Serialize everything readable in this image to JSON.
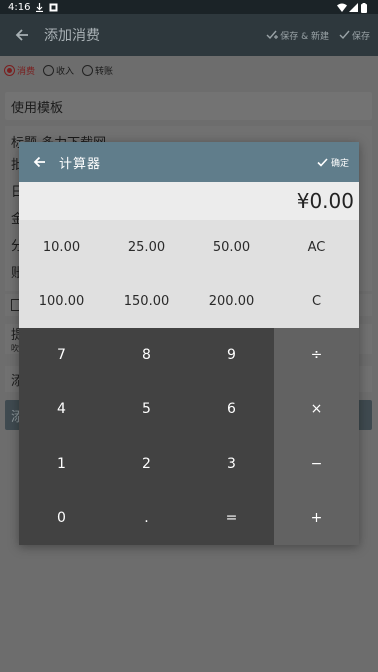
{
  "status_bar": {
    "time": "4:16"
  },
  "toolbar": {
    "title": "添加消费",
    "save_new_label": "保存 & 新建",
    "save_label": "保存"
  },
  "form": {
    "types": [
      {
        "label": "消费",
        "selected": true
      },
      {
        "label": "收入",
        "selected": false
      },
      {
        "label": "转账",
        "selected": false
      }
    ],
    "template_label": "使用模板",
    "title_field": "标题 多力下载网",
    "partial_labels": [
      "批",
      "日",
      "金",
      "分",
      "账"
    ],
    "peek_rows": [
      "提",
      "添"
    ],
    "peek_detail": "吹",
    "peek_button": "添"
  },
  "calculator": {
    "title": "计算器",
    "confirm_label": "确定",
    "display_value": "¥0.00",
    "presets": [
      "10.00",
      "25.00",
      "50.00",
      "AC",
      "100.00",
      "150.00",
      "200.00",
      "C"
    ],
    "keys": [
      "7",
      "8",
      "9",
      "÷",
      "4",
      "5",
      "6",
      "×",
      "1",
      "2",
      "3",
      "−",
      "0",
      ".",
      "=",
      "+"
    ]
  }
}
